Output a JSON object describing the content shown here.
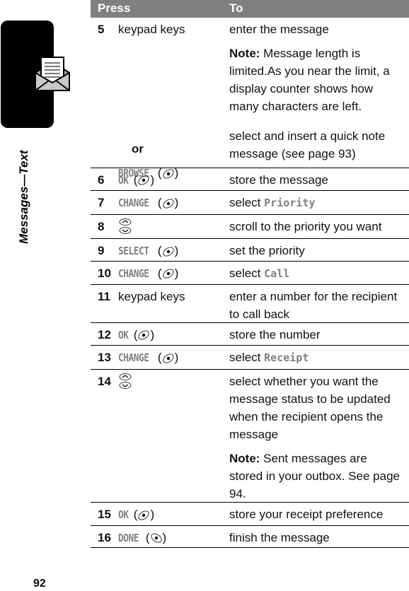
{
  "sidebar": {
    "section_label": "Messages—Text",
    "icon": "envelope-message-icon"
  },
  "page_number": "92",
  "table": {
    "headers": {
      "press": "Press",
      "to": "To"
    },
    "rows": [
      {
        "num": "5",
        "press": "keypad keys",
        "to": "enter the message",
        "note_label": "Note:",
        "note": " Message length is limited.As you near the limit, a display counter shows how many characters are left.",
        "alt_or": "or",
        "alt_key": "BROWSE",
        "alt_icon": "left-soft-key-icon",
        "alt_to": "select and insert a quick note message (see page 93)"
      },
      {
        "num": "6",
        "key": "OK",
        "icon": "left-soft-key-icon",
        "to": "store the message"
      },
      {
        "num": "7",
        "key": "CHANGE",
        "icon": "left-soft-key-icon",
        "to_prefix": "select ",
        "to_term": "Priority"
      },
      {
        "num": "8",
        "icon": "scroll-up-down-icon",
        "to": "scroll to the priority you want"
      },
      {
        "num": "9",
        "key": "SELECT",
        "icon": "left-soft-key-icon",
        "to": "set the priority"
      },
      {
        "num": "10",
        "key": "CHANGE",
        "icon": "left-soft-key-icon",
        "to_prefix": "select ",
        "to_term": "Call"
      },
      {
        "num": "11",
        "press": "keypad keys",
        "to": "enter a number for the recipient to call back"
      },
      {
        "num": "12",
        "key": "OK",
        "icon": "left-soft-key-icon",
        "to": "store the number"
      },
      {
        "num": "13",
        "key": "CHANGE",
        "icon": "left-soft-key-icon",
        "to_prefix": "select ",
        "to_term": "Receipt"
      },
      {
        "num": "14",
        "icon": "scroll-up-down-icon",
        "to": "select whether you want the message status to be updated when the recipient opens the message",
        "note_label": "Note:",
        "note": " Sent messages are stored in your outbox. See page 94."
      },
      {
        "num": "15",
        "key": "OK",
        "icon": "left-soft-key-icon",
        "to": "store your receipt preference"
      },
      {
        "num": "16",
        "key": "DONE",
        "icon": "right-soft-key-icon",
        "to": "finish the message"
      }
    ]
  }
}
